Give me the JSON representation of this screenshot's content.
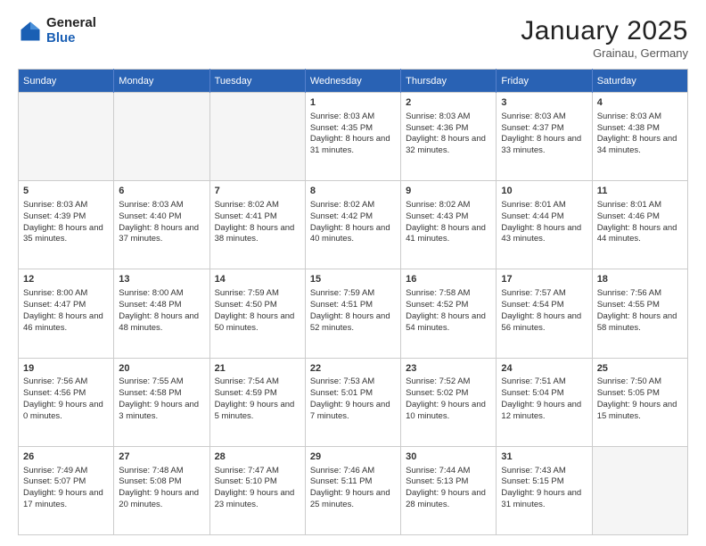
{
  "header": {
    "logo_line1": "General",
    "logo_line2": "Blue",
    "month": "January 2025",
    "location": "Grainau, Germany"
  },
  "weekdays": [
    "Sunday",
    "Monday",
    "Tuesday",
    "Wednesday",
    "Thursday",
    "Friday",
    "Saturday"
  ],
  "weeks": [
    [
      {
        "day": "",
        "info": "",
        "empty": true
      },
      {
        "day": "",
        "info": "",
        "empty": true
      },
      {
        "day": "",
        "info": "",
        "empty": true
      },
      {
        "day": "1",
        "info": "Sunrise: 8:03 AM\nSunset: 4:35 PM\nDaylight: 8 hours and 31 minutes."
      },
      {
        "day": "2",
        "info": "Sunrise: 8:03 AM\nSunset: 4:36 PM\nDaylight: 8 hours and 32 minutes."
      },
      {
        "day": "3",
        "info": "Sunrise: 8:03 AM\nSunset: 4:37 PM\nDaylight: 8 hours and 33 minutes."
      },
      {
        "day": "4",
        "info": "Sunrise: 8:03 AM\nSunset: 4:38 PM\nDaylight: 8 hours and 34 minutes."
      }
    ],
    [
      {
        "day": "5",
        "info": "Sunrise: 8:03 AM\nSunset: 4:39 PM\nDaylight: 8 hours and 35 minutes."
      },
      {
        "day": "6",
        "info": "Sunrise: 8:03 AM\nSunset: 4:40 PM\nDaylight: 8 hours and 37 minutes."
      },
      {
        "day": "7",
        "info": "Sunrise: 8:02 AM\nSunset: 4:41 PM\nDaylight: 8 hours and 38 minutes."
      },
      {
        "day": "8",
        "info": "Sunrise: 8:02 AM\nSunset: 4:42 PM\nDaylight: 8 hours and 40 minutes."
      },
      {
        "day": "9",
        "info": "Sunrise: 8:02 AM\nSunset: 4:43 PM\nDaylight: 8 hours and 41 minutes."
      },
      {
        "day": "10",
        "info": "Sunrise: 8:01 AM\nSunset: 4:44 PM\nDaylight: 8 hours and 43 minutes."
      },
      {
        "day": "11",
        "info": "Sunrise: 8:01 AM\nSunset: 4:46 PM\nDaylight: 8 hours and 44 minutes."
      }
    ],
    [
      {
        "day": "12",
        "info": "Sunrise: 8:00 AM\nSunset: 4:47 PM\nDaylight: 8 hours and 46 minutes."
      },
      {
        "day": "13",
        "info": "Sunrise: 8:00 AM\nSunset: 4:48 PM\nDaylight: 8 hours and 48 minutes."
      },
      {
        "day": "14",
        "info": "Sunrise: 7:59 AM\nSunset: 4:50 PM\nDaylight: 8 hours and 50 minutes."
      },
      {
        "day": "15",
        "info": "Sunrise: 7:59 AM\nSunset: 4:51 PM\nDaylight: 8 hours and 52 minutes."
      },
      {
        "day": "16",
        "info": "Sunrise: 7:58 AM\nSunset: 4:52 PM\nDaylight: 8 hours and 54 minutes."
      },
      {
        "day": "17",
        "info": "Sunrise: 7:57 AM\nSunset: 4:54 PM\nDaylight: 8 hours and 56 minutes."
      },
      {
        "day": "18",
        "info": "Sunrise: 7:56 AM\nSunset: 4:55 PM\nDaylight: 8 hours and 58 minutes."
      }
    ],
    [
      {
        "day": "19",
        "info": "Sunrise: 7:56 AM\nSunset: 4:56 PM\nDaylight: 9 hours and 0 minutes."
      },
      {
        "day": "20",
        "info": "Sunrise: 7:55 AM\nSunset: 4:58 PM\nDaylight: 9 hours and 3 minutes."
      },
      {
        "day": "21",
        "info": "Sunrise: 7:54 AM\nSunset: 4:59 PM\nDaylight: 9 hours and 5 minutes."
      },
      {
        "day": "22",
        "info": "Sunrise: 7:53 AM\nSunset: 5:01 PM\nDaylight: 9 hours and 7 minutes."
      },
      {
        "day": "23",
        "info": "Sunrise: 7:52 AM\nSunset: 5:02 PM\nDaylight: 9 hours and 10 minutes."
      },
      {
        "day": "24",
        "info": "Sunrise: 7:51 AM\nSunset: 5:04 PM\nDaylight: 9 hours and 12 minutes."
      },
      {
        "day": "25",
        "info": "Sunrise: 7:50 AM\nSunset: 5:05 PM\nDaylight: 9 hours and 15 minutes."
      }
    ],
    [
      {
        "day": "26",
        "info": "Sunrise: 7:49 AM\nSunset: 5:07 PM\nDaylight: 9 hours and 17 minutes."
      },
      {
        "day": "27",
        "info": "Sunrise: 7:48 AM\nSunset: 5:08 PM\nDaylight: 9 hours and 20 minutes."
      },
      {
        "day": "28",
        "info": "Sunrise: 7:47 AM\nSunset: 5:10 PM\nDaylight: 9 hours and 23 minutes."
      },
      {
        "day": "29",
        "info": "Sunrise: 7:46 AM\nSunset: 5:11 PM\nDaylight: 9 hours and 25 minutes."
      },
      {
        "day": "30",
        "info": "Sunrise: 7:44 AM\nSunset: 5:13 PM\nDaylight: 9 hours and 28 minutes."
      },
      {
        "day": "31",
        "info": "Sunrise: 7:43 AM\nSunset: 5:15 PM\nDaylight: 9 hours and 31 minutes."
      },
      {
        "day": "",
        "info": "",
        "empty": true
      }
    ]
  ]
}
